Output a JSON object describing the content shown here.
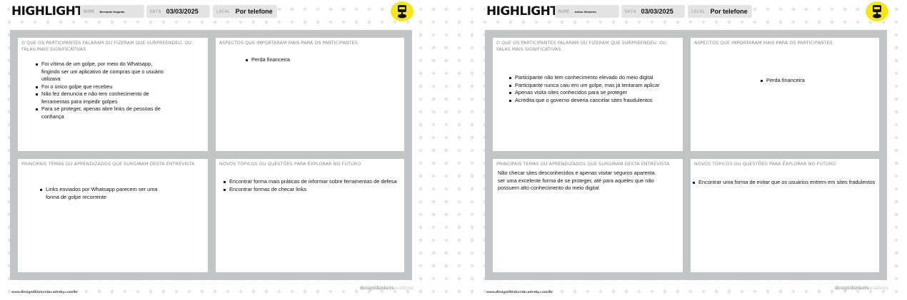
{
  "left": {
    "title": "HIGHLIGHTS",
    "nome_label": "NOME",
    "nome_value": "Bernardo Segurão",
    "data_label": "DATA",
    "data_value": "03/03/2025",
    "local_label": "LOCAL",
    "local_value": "Por telefone",
    "q1_title": "O QUE OS PARTICIPANTES FALARAM OU FIZERAM QUE SURPREENDEU, OU FALAS MAIS SIGNIFICATIVAS",
    "q1_items": [
      "Foi vítima de um golpe, por meio do Whatsapp, fingindo ser um aplicativo de compras que o usuário utilizava",
      "Foi o único golpe que recebeu",
      "Não fez denuncia e não tem conhecimento de ferramentas para impedir golpes",
      "Para se proteger, apenas abre links de pessoas de confiança"
    ],
    "q2_title": "ASPECTOS QUE IMPORTARAM MAIS PARA OS PARTICIPANTES",
    "q2_items": [
      "Perda financeira"
    ],
    "q3_title": "PRINCIPAIS TEMAS OU APRENDIZADOS QUE SURGIRAM DESTA ENTREVISTA",
    "q3_items": [
      "Links enviados por Whatsapp parecem ser uma forma de golpe recorrente"
    ],
    "q4_title": "NOVOS TÓPICOS OU QUESTÕES PARA EXPLORAR NO FUTURO",
    "q4_items": [
      "Encontrar forma mais práticas de informar sobre ferramentas de defesa",
      "Encontrar formas de checar links"
    ],
    "footer_url": "www.designthinkersacademy.com/br",
    "footer_logo_a": "designthinkers",
    "footer_logo_b": "academy"
  },
  "right": {
    "title": "HIGHLIGHTS",
    "nome_label": "NOME",
    "nome_value": "Arthur Monteiro",
    "data_label": "DATA",
    "data_value": "03/03/2025",
    "local_label": "LOCAL",
    "local_value": "Por telefone",
    "q1_title": "O QUE OS PARTICIPANTES FALARAM OU FIZERAM QUE SURPREENDEU, OU FALAS MAIS SIGNIFICATIVAS",
    "q1_items": [
      "Participante não tem conhecimento elevado do meio digital",
      "Participante nunca caiu em um golpe, mas já tentaram aplicar",
      "Apenas visita sites conhecidos para se proteger",
      "Acredita que o governo deveria cancelar sites fraudulentos"
    ],
    "q2_title": "ASPECTOS QUE IMPORTARAM MAIS PARA OS PARTICIPANTES",
    "q2_items": [
      "Perda financeira"
    ],
    "q3_title": "PRINCIPAIS TEMAS OU APRENDIZADOS QUE SURGIRAM DESTA ENTREVISTA",
    "q3_text": "Não checar sites desconhecidos e apenas visitar seguros aparenta ser uma excelente forma de se proteger, até para aqueles que não possuem alto conhecimento do meio digital",
    "q4_title": "NOVOS TÓPICOS OU QUESTÕES PARA EXPLORAR NO FUTURO",
    "q4_items": [
      "Encontrar uma forma de evitar que os usuários entrem em sites fradulentos"
    ],
    "footer_url": "www.designthinkersacademy.com/br",
    "footer_logo_a": "designthinkers",
    "footer_logo_b": "academy"
  },
  "colors": {
    "badge": "#f5e614",
    "frame": "#c3c4c5",
    "field": "#e4e4e4"
  },
  "icons": {
    "badge": "robot-badge-icon"
  }
}
